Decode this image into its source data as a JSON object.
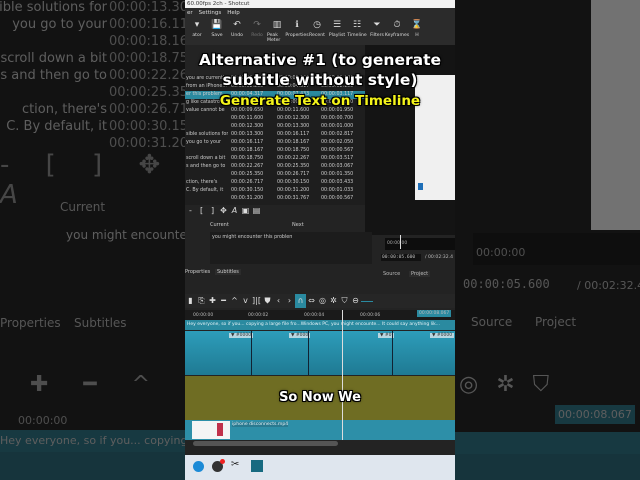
{
  "window": {
    "title": "60.00fps 2ch - Shotcut"
  },
  "menu": [
    "er",
    "Settings",
    "Help"
  ],
  "toolbar": [
    {
      "label": "ator",
      "icon": "dropdown-icon"
    },
    {
      "label": "Save",
      "icon": "save-icon"
    },
    {
      "label": "Undo",
      "icon": "undo-icon"
    },
    {
      "label": "Redo",
      "icon": "redo-icon"
    },
    {
      "label": "Peak Meter",
      "icon": "peak-meter-icon"
    },
    {
      "label": "Properties",
      "icon": "info-icon"
    },
    {
      "label": "Recent",
      "icon": "clock-icon"
    },
    {
      "label": "Playlist",
      "icon": "list-icon"
    },
    {
      "label": "Timeline",
      "icon": "timeline-icon"
    },
    {
      "label": "Filters",
      "icon": "filter-icon"
    },
    {
      "label": "Keyframes",
      "icon": "stopwatch-icon"
    },
    {
      "label": "H",
      "icon": "history-icon"
    }
  ],
  "subtitles": [
    {
      "text": "you are currently",
      "start": "00:00:00.000",
      "end": "00:00:02.200",
      "dur": "00:00:02.100"
    },
    {
      "text": "from an iPhone...",
      "start": "00:00:02.200",
      "end": "00:00:04.317",
      "end2": "",
      "dur": "00:00:02.100"
    },
    {
      "text": "er this problem",
      "start": "00:00:04.317",
      "end": "00:00:07.433",
      "dur": "00:00:03.117"
    },
    {
      "text": "g like catastrophic",
      "start": "00:00:07.433",
      "end": "00:00:09.650",
      "dur": "00:00:02.200"
    },
    {
      "text": "value cannot be",
      "start": "00:00:09.650",
      "end": "00:00:11.600",
      "dur": "00:00:01.950"
    },
    {
      "text": "",
      "start": "00:00:11.600",
      "end": "00:00:12.300",
      "dur": "00:00:00.700"
    },
    {
      "text": "",
      "start": "00:00:12.300",
      "end": "00:00:13.300",
      "dur": "00:00:01.000"
    },
    {
      "text": "sible solutions for",
      "start": "00:00:13.300",
      "end": "00:00:16.117",
      "dur": "00:00:02.817"
    },
    {
      "text": "you go to your",
      "start": "00:00:16.117",
      "end": "00:00:18.167",
      "dur": "00:00:02.050"
    },
    {
      "text": "",
      "start": "00:00:18.167",
      "end": "00:00:18.750",
      "dur": "00:00:00.567"
    },
    {
      "text": "scroll down a bit",
      "start": "00:00:18.750",
      "end": "00:00:22.267",
      "dur": "00:00:03.517"
    },
    {
      "text": "s and then go to",
      "start": "00:00:22.267",
      "end": "00:00:25.350",
      "dur": "00:00:03.067"
    },
    {
      "text": "",
      "start": "00:00:25.350",
      "end": "00:00:26.717",
      "dur": "00:00:01.350"
    },
    {
      "text": "ction, there's",
      "start": "00:00:26.717",
      "end": "00:00:30.150",
      "dur": "00:00:03.433"
    },
    {
      "text": "C. By default, it",
      "start": "00:00:30.150",
      "end": "00:00:31.200",
      "dur": "00:00:01.033"
    },
    {
      "text": "",
      "start": "00:00:31.200",
      "end": "00:00:31.767",
      "dur": "00:00:00.567"
    }
  ],
  "editor": {
    "current_label": "Current",
    "next_label": "Next",
    "current_text": "you might encounter this problem"
  },
  "tabs": {
    "properties": "Properties",
    "subtitles": "Subtitles",
    "source": "Source",
    "project": "Project"
  },
  "player": {
    "ruler_start": "00:00:00",
    "ruler_next": "00:00:0",
    "timecode": "00:00:05.600",
    "duration": "/ 00:02:32.4"
  },
  "timeline": {
    "ruler": [
      "00:00:00",
      "00:00:02",
      "00:00:04",
      "00:00:06"
    ],
    "playhead_time": "00:00:08.067",
    "subtitle_track": "Hey everyone, so if you... copying a large file fro...Windows PC, you might encounte... It could say anything lik...",
    "filter_labels": [
      "#0000",
      "#000",
      "#0",
      "#0000"
    ],
    "audio_clip": "iphone disconnects.mp4"
  },
  "overlay": {
    "line1": "Alternative #1 (to generate",
    "line2": "subtitle without style)",
    "line3": "Generate Text on Timeline",
    "caption": "So Now We"
  },
  "colors": {
    "accent": "#2a8aa0",
    "track": "#2d8fa8",
    "olive": "#6f6d23",
    "caption_yellow": "#f4f41a"
  }
}
